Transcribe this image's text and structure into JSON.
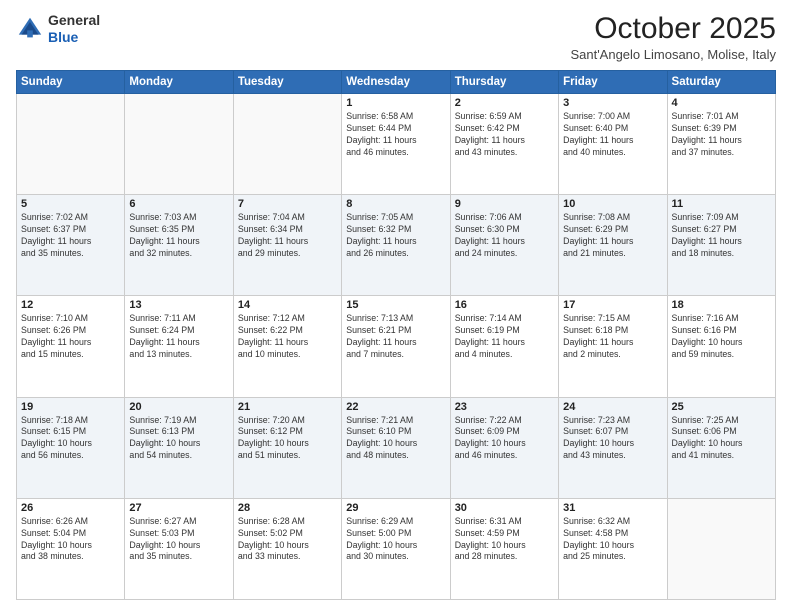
{
  "header": {
    "logo_general": "General",
    "logo_blue": "Blue",
    "month": "October 2025",
    "location": "Sant'Angelo Limosano, Molise, Italy"
  },
  "days_of_week": [
    "Sunday",
    "Monday",
    "Tuesday",
    "Wednesday",
    "Thursday",
    "Friday",
    "Saturday"
  ],
  "weeks": [
    [
      {
        "day": "",
        "info": ""
      },
      {
        "day": "",
        "info": ""
      },
      {
        "day": "",
        "info": ""
      },
      {
        "day": "1",
        "info": "Sunrise: 6:58 AM\nSunset: 6:44 PM\nDaylight: 11 hours\nand 46 minutes."
      },
      {
        "day": "2",
        "info": "Sunrise: 6:59 AM\nSunset: 6:42 PM\nDaylight: 11 hours\nand 43 minutes."
      },
      {
        "day": "3",
        "info": "Sunrise: 7:00 AM\nSunset: 6:40 PM\nDaylight: 11 hours\nand 40 minutes."
      },
      {
        "day": "4",
        "info": "Sunrise: 7:01 AM\nSunset: 6:39 PM\nDaylight: 11 hours\nand 37 minutes."
      }
    ],
    [
      {
        "day": "5",
        "info": "Sunrise: 7:02 AM\nSunset: 6:37 PM\nDaylight: 11 hours\nand 35 minutes."
      },
      {
        "day": "6",
        "info": "Sunrise: 7:03 AM\nSunset: 6:35 PM\nDaylight: 11 hours\nand 32 minutes."
      },
      {
        "day": "7",
        "info": "Sunrise: 7:04 AM\nSunset: 6:34 PM\nDaylight: 11 hours\nand 29 minutes."
      },
      {
        "day": "8",
        "info": "Sunrise: 7:05 AM\nSunset: 6:32 PM\nDaylight: 11 hours\nand 26 minutes."
      },
      {
        "day": "9",
        "info": "Sunrise: 7:06 AM\nSunset: 6:30 PM\nDaylight: 11 hours\nand 24 minutes."
      },
      {
        "day": "10",
        "info": "Sunrise: 7:08 AM\nSunset: 6:29 PM\nDaylight: 11 hours\nand 21 minutes."
      },
      {
        "day": "11",
        "info": "Sunrise: 7:09 AM\nSunset: 6:27 PM\nDaylight: 11 hours\nand 18 minutes."
      }
    ],
    [
      {
        "day": "12",
        "info": "Sunrise: 7:10 AM\nSunset: 6:26 PM\nDaylight: 11 hours\nand 15 minutes."
      },
      {
        "day": "13",
        "info": "Sunrise: 7:11 AM\nSunset: 6:24 PM\nDaylight: 11 hours\nand 13 minutes."
      },
      {
        "day": "14",
        "info": "Sunrise: 7:12 AM\nSunset: 6:22 PM\nDaylight: 11 hours\nand 10 minutes."
      },
      {
        "day": "15",
        "info": "Sunrise: 7:13 AM\nSunset: 6:21 PM\nDaylight: 11 hours\nand 7 minutes."
      },
      {
        "day": "16",
        "info": "Sunrise: 7:14 AM\nSunset: 6:19 PM\nDaylight: 11 hours\nand 4 minutes."
      },
      {
        "day": "17",
        "info": "Sunrise: 7:15 AM\nSunset: 6:18 PM\nDaylight: 11 hours\nand 2 minutes."
      },
      {
        "day": "18",
        "info": "Sunrise: 7:16 AM\nSunset: 6:16 PM\nDaylight: 10 hours\nand 59 minutes."
      }
    ],
    [
      {
        "day": "19",
        "info": "Sunrise: 7:18 AM\nSunset: 6:15 PM\nDaylight: 10 hours\nand 56 minutes."
      },
      {
        "day": "20",
        "info": "Sunrise: 7:19 AM\nSunset: 6:13 PM\nDaylight: 10 hours\nand 54 minutes."
      },
      {
        "day": "21",
        "info": "Sunrise: 7:20 AM\nSunset: 6:12 PM\nDaylight: 10 hours\nand 51 minutes."
      },
      {
        "day": "22",
        "info": "Sunrise: 7:21 AM\nSunset: 6:10 PM\nDaylight: 10 hours\nand 48 minutes."
      },
      {
        "day": "23",
        "info": "Sunrise: 7:22 AM\nSunset: 6:09 PM\nDaylight: 10 hours\nand 46 minutes."
      },
      {
        "day": "24",
        "info": "Sunrise: 7:23 AM\nSunset: 6:07 PM\nDaylight: 10 hours\nand 43 minutes."
      },
      {
        "day": "25",
        "info": "Sunrise: 7:25 AM\nSunset: 6:06 PM\nDaylight: 10 hours\nand 41 minutes."
      }
    ],
    [
      {
        "day": "26",
        "info": "Sunrise: 6:26 AM\nSunset: 5:04 PM\nDaylight: 10 hours\nand 38 minutes."
      },
      {
        "day": "27",
        "info": "Sunrise: 6:27 AM\nSunset: 5:03 PM\nDaylight: 10 hours\nand 35 minutes."
      },
      {
        "day": "28",
        "info": "Sunrise: 6:28 AM\nSunset: 5:02 PM\nDaylight: 10 hours\nand 33 minutes."
      },
      {
        "day": "29",
        "info": "Sunrise: 6:29 AM\nSunset: 5:00 PM\nDaylight: 10 hours\nand 30 minutes."
      },
      {
        "day": "30",
        "info": "Sunrise: 6:31 AM\nSunset: 4:59 PM\nDaylight: 10 hours\nand 28 minutes."
      },
      {
        "day": "31",
        "info": "Sunrise: 6:32 AM\nSunset: 4:58 PM\nDaylight: 10 hours\nand 25 minutes."
      },
      {
        "day": "",
        "info": ""
      }
    ]
  ]
}
